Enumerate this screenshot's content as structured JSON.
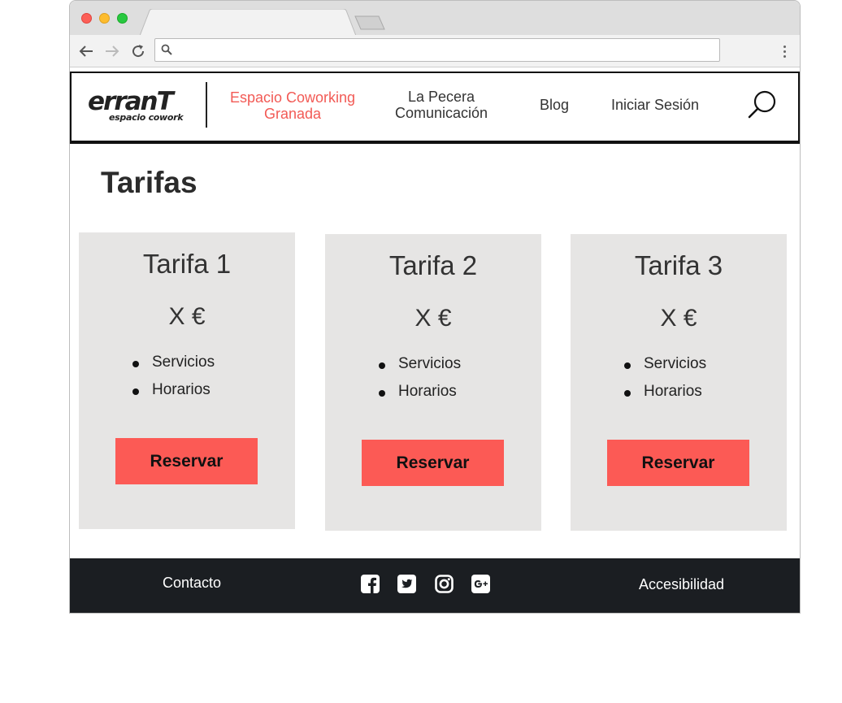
{
  "header": {
    "logo": {
      "main": "erranT",
      "sub": "espacio cowork"
    },
    "nav": [
      {
        "line1": "Espacio Coworking",
        "line2": "Granada",
        "active": true
      },
      {
        "line1": "La Pecera",
        "line2": "Comunicación",
        "active": false
      },
      {
        "label": "Blog"
      },
      {
        "label": "Iniciar Sesión"
      }
    ],
    "search_icon": "search-icon"
  },
  "main": {
    "title": "Tarifas",
    "cards": [
      {
        "title": "Tarifa 1",
        "price": "X €",
        "items": [
          "Servicios",
          "Horarios"
        ],
        "button": "Reservar"
      },
      {
        "title": "Tarifa 2",
        "price": "X €",
        "items": [
          "Servicios",
          "Horarios"
        ],
        "button": "Reservar"
      },
      {
        "title": "Tarifa 3",
        "price": "X €",
        "items": [
          "Servicios",
          "Horarios"
        ],
        "button": "Reservar"
      }
    ]
  },
  "footer": {
    "contact": "Contacto",
    "accessibility": "Accesibilidad",
    "social": [
      "facebook-icon",
      "twitter-icon",
      "instagram-icon",
      "google-plus-icon"
    ]
  },
  "colors": {
    "accent": "#f25a55",
    "button": "#fc5a55",
    "card_bg": "#e6e5e4",
    "footer_bg": "#1b1e22"
  }
}
